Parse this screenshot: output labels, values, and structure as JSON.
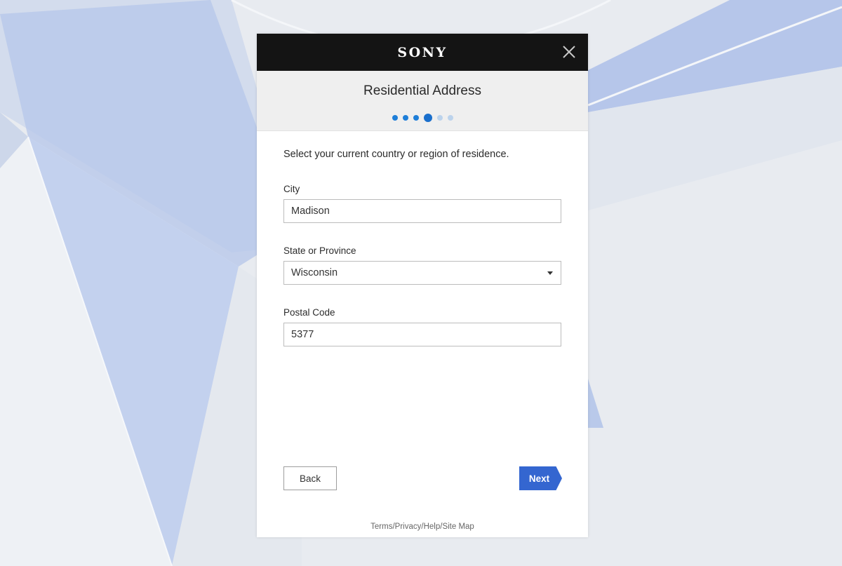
{
  "header": {
    "brand": "SONY",
    "title": "Residential Address",
    "steps": {
      "total": 6,
      "current": 4
    }
  },
  "form": {
    "intro": "Select your current country or region of residence.",
    "city": {
      "label": "City",
      "value": "Madison"
    },
    "state": {
      "label": "State or Province",
      "value": "Wisconsin"
    },
    "postal": {
      "label": "Postal Code",
      "value": "5377"
    }
  },
  "actions": {
    "back_label": "Back",
    "next_label": "Next"
  },
  "footer": {
    "terms": "Terms",
    "privacy": "Privacy",
    "help": "Help",
    "sitemap": "Site Map",
    "separator": "/"
  },
  "colors": {
    "topbar": "#141414",
    "accent": "#3466d0",
    "step_active": "#1e7ed8",
    "step_pending": "#bcd3ec"
  },
  "icons": {
    "close": "close-icon",
    "dropdown": "chevron-down-icon"
  }
}
